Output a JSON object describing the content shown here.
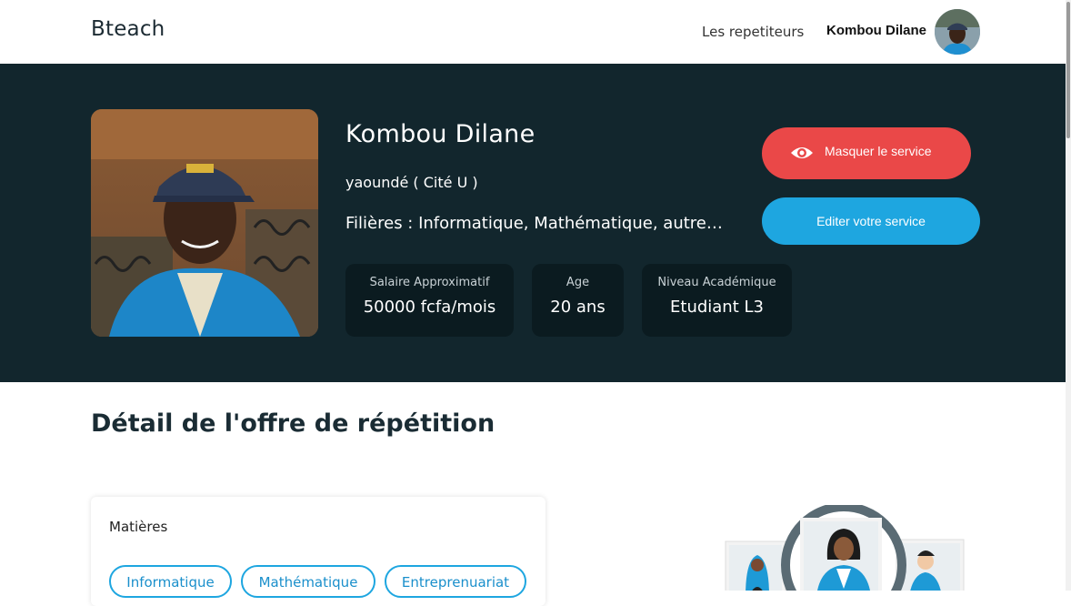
{
  "header": {
    "brand": "Bteach",
    "nav_tutors": "Les repetiteurs",
    "user_name": "Kombou Dilane"
  },
  "profile": {
    "name": "Kombou Dilane",
    "location": "yaoundé ( Cité U )",
    "filieres": "Filières : Informatique, Mathématique, autres ...",
    "stats": {
      "salary_label": "Salaire Approximatif",
      "salary_value": "50000 fcfa/mois",
      "age_label": "Age",
      "age_value": "20 ans",
      "level_label": "Niveau Académique",
      "level_value": "Etudiant L3"
    },
    "actions": {
      "hide_label": "Masquer le service",
      "edit_label": "Editer votre service"
    }
  },
  "details": {
    "title": "Détail de l'offre de répétition",
    "subjects_title": "Matières",
    "subjects": [
      "Informatique",
      "Mathématique",
      "Entreprenuariat"
    ]
  },
  "colors": {
    "hero_bg": "#12262d",
    "stat_bg": "#0b1b20",
    "hide_button": "#ea4848",
    "edit_button": "#1ea6e0"
  }
}
